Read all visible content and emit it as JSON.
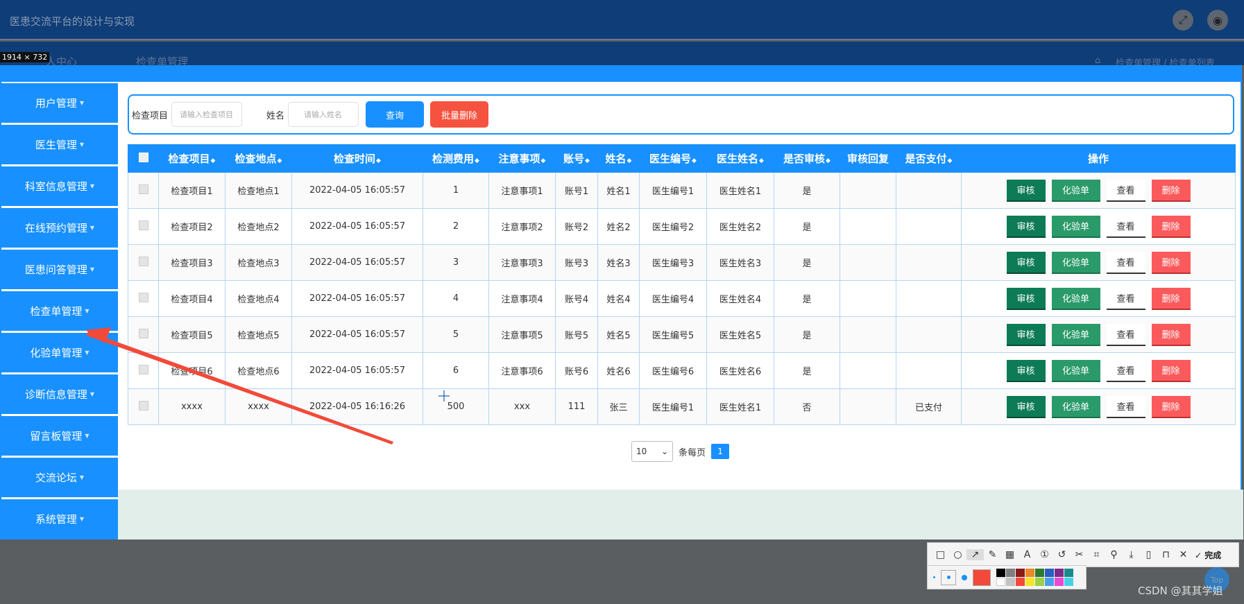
{
  "header": {
    "title": "医患交流平台的设计与实现",
    "ghost_nav": "人中心",
    "ghost_page": "检查单管理",
    "ghost_breadcrumb": "检查单管理 / 检查单列表",
    "size_badge": "1914 × 732"
  },
  "sidebar": {
    "items": [
      {
        "label": "用户管理"
      },
      {
        "label": "医生管理"
      },
      {
        "label": "科室信息管理"
      },
      {
        "label": "在线预约管理"
      },
      {
        "label": "医患问答管理"
      },
      {
        "label": "检查单管理"
      },
      {
        "label": "化验单管理"
      },
      {
        "label": "诊断信息管理"
      },
      {
        "label": "留言板管理"
      },
      {
        "label": "交流论坛"
      },
      {
        "label": "系统管理"
      }
    ]
  },
  "search": {
    "item_label": "检查项目",
    "item_placeholder": "请输入检查项目",
    "name_label": "姓名",
    "name_placeholder": "请输入姓名",
    "query_button": "查询",
    "batch_delete_button": "批量删除"
  },
  "table": {
    "columns": [
      "检查项目",
      "检查地点",
      "检查时间",
      "检测费用",
      "注意事项",
      "账号",
      "姓名",
      "医生编号",
      "医生姓名",
      "是否审核",
      "审核回复",
      "是否支付",
      "操作"
    ],
    "rows": [
      [
        "检查项目1",
        "检查地点1",
        "2022-04-05 16:05:57",
        "1",
        "注意事项1",
        "账号1",
        "姓名1",
        "医生编号1",
        "医生姓名1",
        "是",
        "",
        ""
      ],
      [
        "检查项目2",
        "检查地点2",
        "2022-04-05 16:05:57",
        "2",
        "注意事项2",
        "账号2",
        "姓名2",
        "医生编号2",
        "医生姓名2",
        "是",
        "",
        ""
      ],
      [
        "检查项目3",
        "检查地点3",
        "2022-04-05 16:05:57",
        "3",
        "注意事项3",
        "账号3",
        "姓名3",
        "医生编号3",
        "医生姓名3",
        "是",
        "",
        ""
      ],
      [
        "检查项目4",
        "检查地点4",
        "2022-04-05 16:05:57",
        "4",
        "注意事项4",
        "账号4",
        "姓名4",
        "医生编号4",
        "医生姓名4",
        "是",
        "",
        ""
      ],
      [
        "检查项目5",
        "检查地点5",
        "2022-04-05 16:05:57",
        "5",
        "注意事项5",
        "账号5",
        "姓名5",
        "医生编号5",
        "医生姓名5",
        "是",
        "",
        ""
      ],
      [
        "检查项目6",
        "检查地点6",
        "2022-04-05 16:05:57",
        "6",
        "注意事项6",
        "账号6",
        "姓名6",
        "医生编号6",
        "医生姓名6",
        "是",
        "",
        ""
      ],
      [
        "xxxx",
        "xxxx",
        "2022-04-05 16:16:26",
        "500",
        "xxx",
        "111",
        "张三",
        "医生编号1",
        "医生姓名1",
        "否",
        "",
        "已支付"
      ]
    ],
    "actions": {
      "review": "审核",
      "lab": "化验单",
      "view": "查看",
      "delete": "删除"
    }
  },
  "pagination": {
    "page_size": "10",
    "per_page_label": "条每页",
    "current_page": "1"
  },
  "screenshot_tool": {
    "done_label": "完成",
    "top_label": "Top",
    "watermark": "CSDN @其其学姐"
  },
  "colors": {
    "primary": "#1890ff",
    "header": "#0f3d78",
    "success": "#0d7b55",
    "danger": "#fb5a5c",
    "annotation": "#f24a3a"
  },
  "icons": [
    "fullscreen-icon",
    "user-avatar-icon",
    "home-icon",
    "sort-icon",
    "chevron-down-icon"
  ]
}
